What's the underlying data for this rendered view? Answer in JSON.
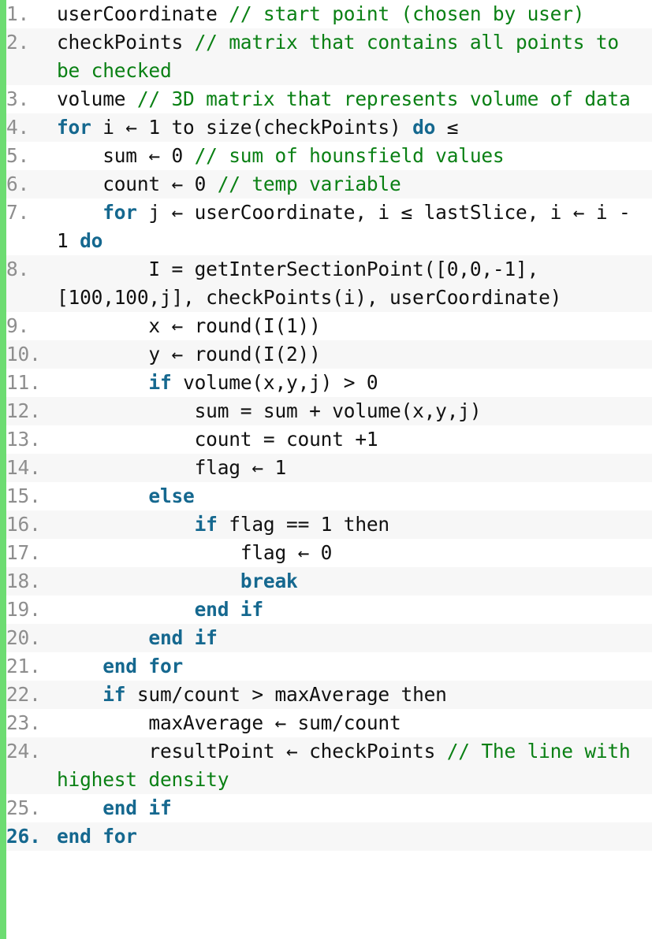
{
  "document": {
    "kind": "pseudocode-listing",
    "title": "",
    "gutter_accent_color": "#6ddc72",
    "keyword_color": "#15688f",
    "comment_color": "#0a8014",
    "text_color": "#111111",
    "line_number_color": "#8e8e8e",
    "row_background": "#ffffff",
    "row_background_alt": "#f7f7f7",
    "total_lines": 26
  },
  "lines": [
    {
      "number": "1.",
      "bold": false,
      "tokens": [
        {
          "type": "plain",
          "text": "userCoordinate "
        },
        {
          "type": "comment",
          "text": "// start point (chosen by user)"
        }
      ]
    },
    {
      "number": "2.",
      "bold": false,
      "tokens": [
        {
          "type": "plain",
          "text": "checkPoints "
        },
        {
          "type": "comment",
          "text": "// matrix that contains all points to be checked"
        }
      ]
    },
    {
      "number": "3.",
      "bold": false,
      "tokens": [
        {
          "type": "plain",
          "text": "volume "
        },
        {
          "type": "comment",
          "text": "// 3D matrix that represents volume of data"
        }
      ]
    },
    {
      "number": "4.",
      "bold": false,
      "tokens": [
        {
          "type": "keyword",
          "text": "for"
        },
        {
          "type": "plain",
          "text": " i ← 1 to size(checkPoints) "
        },
        {
          "type": "keyword",
          "text": "do"
        },
        {
          "type": "plain",
          "text": " ≤"
        }
      ]
    },
    {
      "number": "5.",
      "bold": false,
      "tokens": [
        {
          "type": "plain",
          "text": "    sum ← 0 "
        },
        {
          "type": "comment",
          "text": "// sum of hounsfield values"
        }
      ]
    },
    {
      "number": "6.",
      "bold": false,
      "tokens": [
        {
          "type": "plain",
          "text": "    count ← 0 "
        },
        {
          "type": "comment",
          "text": "// temp variable"
        }
      ]
    },
    {
      "number": "7.",
      "bold": false,
      "tokens": [
        {
          "type": "plain",
          "text": "    "
        },
        {
          "type": "keyword",
          "text": "for"
        },
        {
          "type": "plain",
          "text": " j ← userCoordinate, i ≤ lastSlice, i ← i - 1 "
        },
        {
          "type": "keyword",
          "text": "do"
        }
      ]
    },
    {
      "number": "8.",
      "bold": false,
      "tokens": [
        {
          "type": "plain",
          "text": "        I = getInterSectionPoint([0,0,-1],[100,100,j], checkPoints(i), userCoordinate)"
        }
      ]
    },
    {
      "number": "9.",
      "bold": false,
      "tokens": [
        {
          "type": "plain",
          "text": "        x ← round(I(1))"
        }
      ]
    },
    {
      "number": "10.",
      "bold": false,
      "tokens": [
        {
          "type": "plain",
          "text": "        y ← round(I(2))"
        }
      ]
    },
    {
      "number": "11.",
      "bold": false,
      "tokens": [
        {
          "type": "plain",
          "text": "        "
        },
        {
          "type": "keyword",
          "text": "if"
        },
        {
          "type": "plain",
          "text": " volume(x,y,j) > 0"
        }
      ]
    },
    {
      "number": "12.",
      "bold": false,
      "tokens": [
        {
          "type": "plain",
          "text": "            sum = sum + volume(x,y,j)"
        }
      ]
    },
    {
      "number": "13.",
      "bold": false,
      "tokens": [
        {
          "type": "plain",
          "text": "            count = count +1"
        }
      ]
    },
    {
      "number": "14.",
      "bold": false,
      "tokens": [
        {
          "type": "plain",
          "text": "            flag ← 1"
        }
      ]
    },
    {
      "number": "15.",
      "bold": false,
      "tokens": [
        {
          "type": "plain",
          "text": "        "
        },
        {
          "type": "keyword",
          "text": "else"
        }
      ]
    },
    {
      "number": "16.",
      "bold": false,
      "tokens": [
        {
          "type": "plain",
          "text": "            "
        },
        {
          "type": "keyword",
          "text": "if"
        },
        {
          "type": "plain",
          "text": " flag == 1 then"
        }
      ]
    },
    {
      "number": "17.",
      "bold": false,
      "tokens": [
        {
          "type": "plain",
          "text": "                flag ← 0"
        }
      ]
    },
    {
      "number": "18.",
      "bold": false,
      "tokens": [
        {
          "type": "plain",
          "text": "                "
        },
        {
          "type": "keyword",
          "text": "break"
        }
      ]
    },
    {
      "number": "19.",
      "bold": false,
      "tokens": [
        {
          "type": "plain",
          "text": "            "
        },
        {
          "type": "keyword",
          "text": "end if"
        }
      ]
    },
    {
      "number": "20.",
      "bold": false,
      "tokens": [
        {
          "type": "plain",
          "text": "        "
        },
        {
          "type": "keyword",
          "text": "end if"
        }
      ]
    },
    {
      "number": "21.",
      "bold": false,
      "tokens": [
        {
          "type": "plain",
          "text": "    "
        },
        {
          "type": "keyword",
          "text": "end for"
        }
      ]
    },
    {
      "number": "22.",
      "bold": false,
      "tokens": [
        {
          "type": "plain",
          "text": "    "
        },
        {
          "type": "keyword",
          "text": "if"
        },
        {
          "type": "plain",
          "text": " sum/count > maxAverage then"
        }
      ]
    },
    {
      "number": "23.",
      "bold": false,
      "tokens": [
        {
          "type": "plain",
          "text": "        maxAverage ← sum/count"
        }
      ]
    },
    {
      "number": "24.",
      "bold": false,
      "tokens": [
        {
          "type": "plain",
          "text": "        resultPoint ← checkPoints "
        },
        {
          "type": "comment",
          "text": "// The line with highest density"
        }
      ]
    },
    {
      "number": "25.",
      "bold": false,
      "tokens": [
        {
          "type": "plain",
          "text": "    "
        },
        {
          "type": "keyword",
          "text": "end if"
        }
      ]
    },
    {
      "number": "26.",
      "bold": true,
      "tokens": [
        {
          "type": "keyword",
          "text": "end for"
        }
      ]
    }
  ]
}
